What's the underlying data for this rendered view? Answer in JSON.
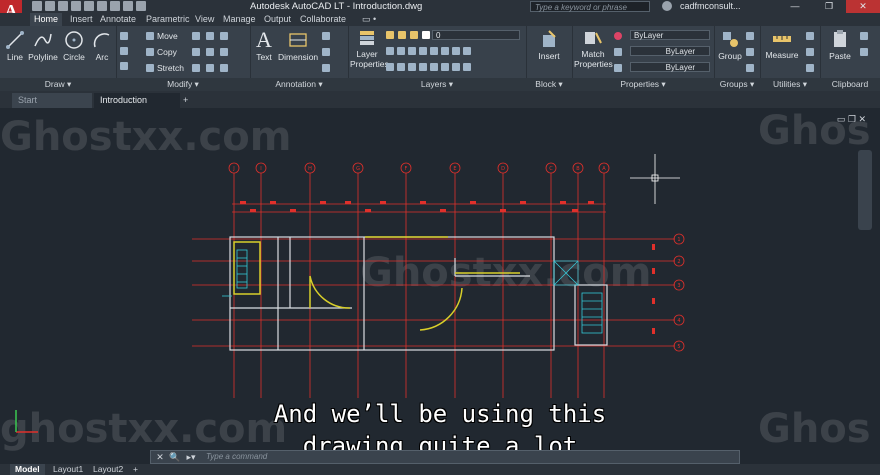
{
  "window": {
    "app_logo": "A",
    "title": "Autodesk AutoCAD LT  -  Introduction.dwg",
    "search_placeholder": "Type a keyword or phrase",
    "user": "cadfmconsult...",
    "min": "—",
    "max": "❐",
    "close": "✕"
  },
  "ribbon_tabs": [
    "Home",
    "Insert",
    "Annotate",
    "Parametric",
    "View",
    "Manage",
    "Output",
    "Collaborate"
  ],
  "ribbon_extra": "▭ •",
  "panels": {
    "draw": {
      "title": "Draw ▾",
      "line": "Line",
      "polyline": "Polyline",
      "circle": "Circle",
      "arc": "Arc"
    },
    "modify": {
      "title": "Modify ▾",
      "move": "Move",
      "copy": "Copy",
      "stretch": "Stretch"
    },
    "annotation": {
      "title": "Annotation ▾",
      "text": "Text",
      "dimension": "Dimension"
    },
    "layers": {
      "title": "Layers ▾",
      "layer_properties_1": "Layer",
      "layer_properties_2": "Properties",
      "current_layer": "0"
    },
    "block": {
      "title": "Block ▾",
      "insert": "Insert"
    },
    "properties": {
      "title": "Properties ▾",
      "match_1": "Match",
      "match_2": "Properties",
      "color": "ByLayer",
      "linetype": "ByLayer",
      "lineweight": "ByLayer"
    },
    "groups": {
      "title": "Groups ▾",
      "group": "Group"
    },
    "utilities": {
      "title": "Utilities ▾",
      "measure": "Measure"
    },
    "clipboard": {
      "title": "Clipboard",
      "paste": "Paste"
    }
  },
  "doc_tabs": {
    "start": "Start",
    "introduction": "Introduction",
    "new": "+"
  },
  "viewport_controls": "▭ ❐ ✕",
  "watermarks": [
    "Ghostxx.com",
    "Ghostxx.com",
    "Ghos",
    "ghostxx.com",
    "Ghos",
    "Ghos"
  ],
  "subtitle": {
    "line1": "And we’ll be using this",
    "line2": "drawing quite a lot"
  },
  "command": {
    "placeholder": "Type a command",
    "close": "✕",
    "search": "🔍",
    "prompt": "▸▾"
  },
  "layout_tabs": [
    "Model",
    "Layout1",
    "Layout2",
    "+"
  ],
  "grid_col_labels": [
    "J",
    "I",
    "H",
    "G",
    "F",
    "E",
    "D",
    "C",
    "B",
    "A"
  ],
  "grid_row_labels": [
    "1",
    "2",
    "3",
    "4",
    "5"
  ],
  "colors": {
    "grid_red": "#e0302b",
    "wall_white": "#d9dde2",
    "door_yellow": "#d8cf2a",
    "stair_cyan": "#35c8d8",
    "accent": "#c0282c"
  }
}
